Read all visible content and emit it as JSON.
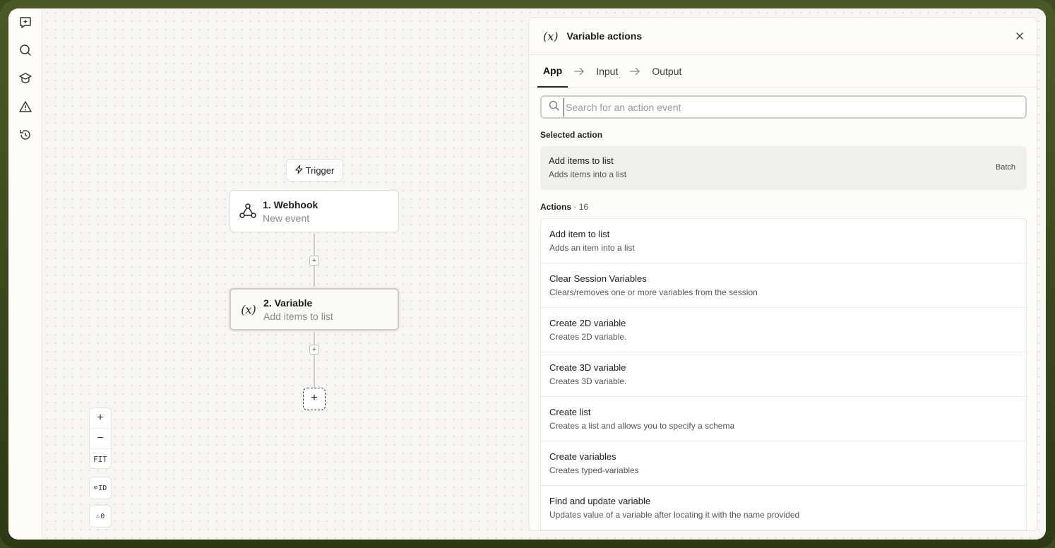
{
  "sidebar": {
    "icons": [
      "sparkle-chat-icon",
      "search-icon",
      "learn-icon",
      "warning-icon",
      "history-icon"
    ]
  },
  "canvas": {
    "trigger_label": "Trigger",
    "nodes": [
      {
        "title": "1. Webhook",
        "subtitle": "New event",
        "icon": "webhook-icon"
      },
      {
        "title": "2. Variable",
        "subtitle": "Add items to list",
        "icon": "variable-icon"
      }
    ],
    "zoom": {
      "zoom_in": "+",
      "zoom_out": "−",
      "fit": "FIT"
    },
    "id_toggle": "ID",
    "warnings": "0"
  },
  "panel": {
    "glyph": "(x)",
    "title": "Variable actions",
    "tabs": [
      "App",
      "Input",
      "Output"
    ],
    "active_tab": "App",
    "search": {
      "placeholder": "Search for an action event",
      "value": ""
    },
    "selected_label": "Selected action",
    "selected_action": {
      "title": "Add items to list",
      "description": "Adds items into a list",
      "badge": "Batch"
    },
    "actions_label": "Actions",
    "actions_count": "16",
    "actions": [
      {
        "title": "Add item to list",
        "description": "Adds an item into a list"
      },
      {
        "title": "Clear Session Variables",
        "description": "Clears/removes one or more variables from the session"
      },
      {
        "title": "Create 2D variable",
        "description": "Creates 2D variable."
      },
      {
        "title": "Create 3D variable",
        "description": "Creates 3D variable."
      },
      {
        "title": "Create list",
        "description": "Creates a list and allows you to specify a schema"
      },
      {
        "title": "Create variables",
        "description": "Creates typed-variables"
      },
      {
        "title": "Find and update variable",
        "description": "Updates value of a variable after locating it with the name provided"
      }
    ]
  },
  "colors": {
    "accent": "#222222",
    "frame": "#3b4a1f",
    "canvas": "#f7f6f2"
  }
}
